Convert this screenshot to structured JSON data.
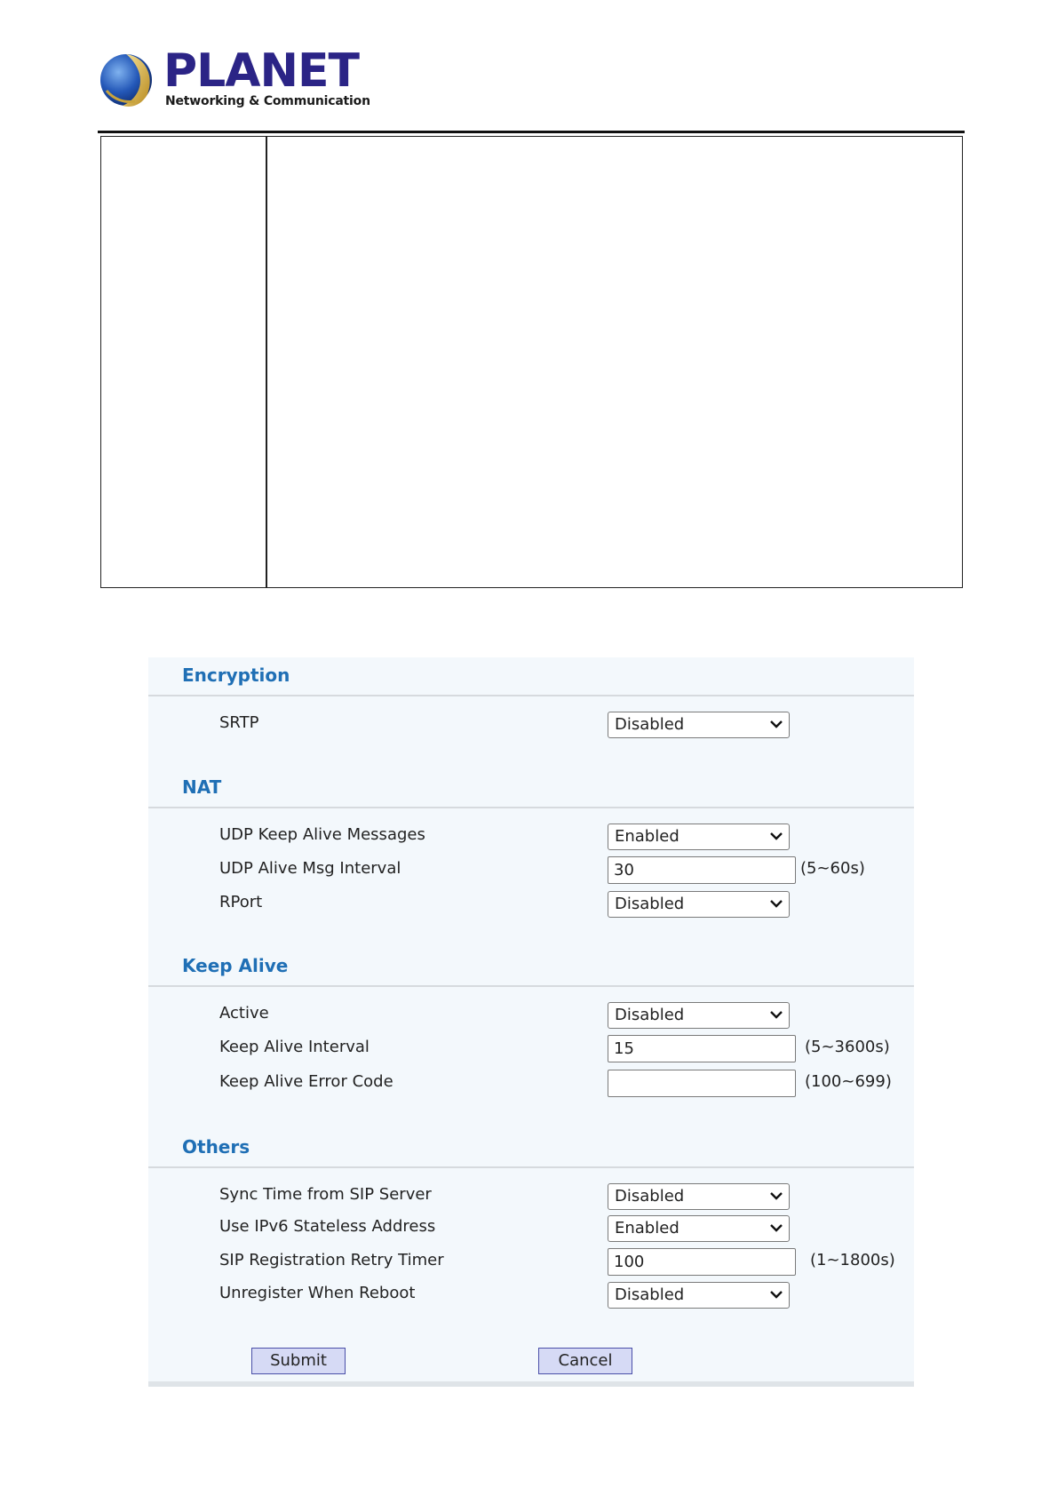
{
  "brand": {
    "name": "PLANET",
    "tagline": "Networking & Communication"
  },
  "sections": {
    "encryption": {
      "title": "Encryption",
      "rows": [
        {
          "label": "SRTP",
          "value": "Disabled"
        }
      ]
    },
    "nat": {
      "title": "NAT",
      "rows": [
        {
          "label": "UDP Keep Alive Messages",
          "value": "Enabled"
        },
        {
          "label": "UDP Alive Msg Interval",
          "value": "30",
          "range": "(5~60s)"
        },
        {
          "label": "RPort",
          "value": "Disabled"
        }
      ]
    },
    "keep_alive": {
      "title": "Keep Alive",
      "rows": [
        {
          "label": "Active",
          "value": "Disabled"
        },
        {
          "label": "Keep Alive Interval",
          "value": "15",
          "range": "(5~3600s)"
        },
        {
          "label": "Keep Alive Error Code",
          "value": "",
          "range": "(100~699)"
        }
      ]
    },
    "others": {
      "title": "Others",
      "rows": [
        {
          "label": "Sync Time from SIP Server",
          "value": "Disabled"
        },
        {
          "label": "Use IPv6 Stateless Address",
          "value": "Enabled"
        },
        {
          "label": "SIP Registration Retry Timer",
          "value": "100",
          "range": "(1~1800s)"
        },
        {
          "label": "Unregister When Reboot",
          "value": "Disabled"
        }
      ]
    }
  },
  "buttons": {
    "submit": "Submit",
    "cancel": "Cancel"
  },
  "colors": {
    "brand": "#2b2486",
    "section_title": "#1f6fb5",
    "panel_bg": "#f3f8fc",
    "button_bg": "#d6daf5"
  }
}
